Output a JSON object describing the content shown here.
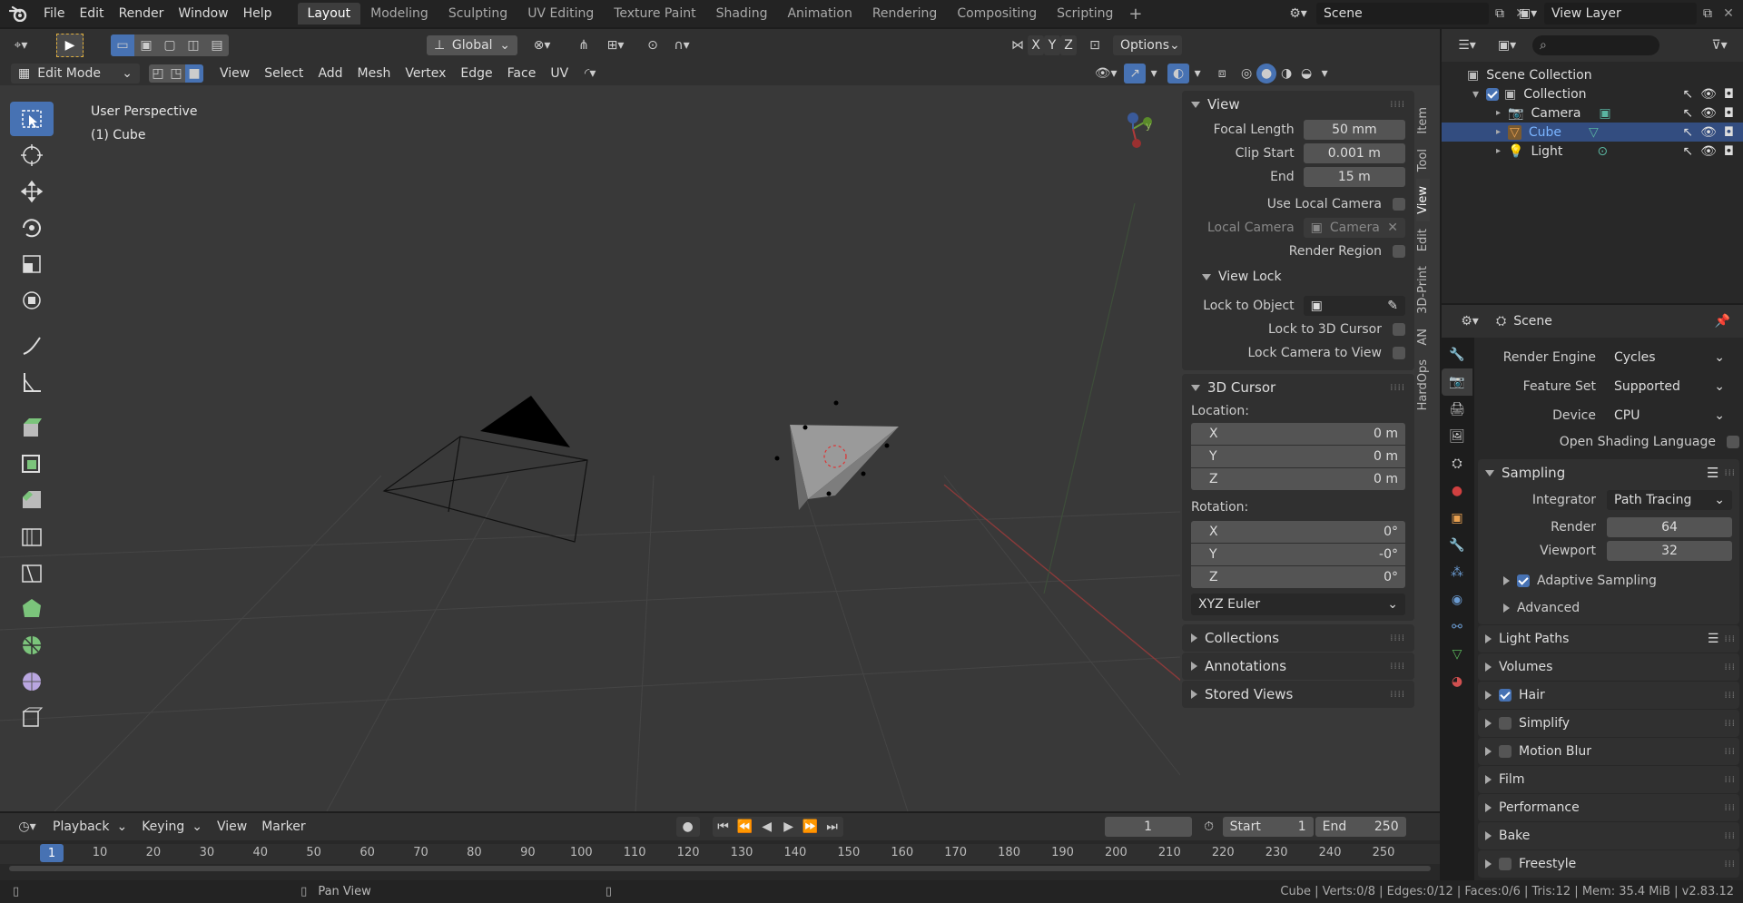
{
  "topbar": {
    "menus": [
      "File",
      "Edit",
      "Render",
      "Window",
      "Help"
    ],
    "workspaces": [
      "Layout",
      "Modeling",
      "Sculpting",
      "UV Editing",
      "Texture Paint",
      "Shading",
      "Animation",
      "Rendering",
      "Compositing",
      "Scripting"
    ],
    "active_workspace": "Layout",
    "scene_name": "Scene",
    "view_layer": "View Layer"
  },
  "header": {
    "orientation": "Global",
    "axes": [
      "X",
      "Y",
      "Z"
    ],
    "options_label": "Options",
    "mode": "Edit Mode",
    "menus": [
      "View",
      "Select",
      "Add",
      "Mesh",
      "Vertex",
      "Edge",
      "Face",
      "UV"
    ]
  },
  "viewport": {
    "perspective": "User Perspective",
    "object": "(1) Cube"
  },
  "sidebar": {
    "tabs": [
      "Item",
      "Tool",
      "View",
      "Edit",
      "3D-Print",
      "AN",
      "HardOps"
    ],
    "active_tab": "View",
    "view": {
      "title": "View",
      "focal_length_label": "Focal Length",
      "focal_length": "50 mm",
      "clip_start_label": "Clip Start",
      "clip_start": "0.001 m",
      "clip_end_label": "End",
      "clip_end": "15 m",
      "use_local_camera": "Use Local Camera",
      "local_camera_label": "Local Camera",
      "local_camera_value": "Camera",
      "render_region": "Render Region",
      "view_lock_title": "View Lock",
      "lock_to_object": "Lock to Object",
      "lock_to_cursor": "Lock to 3D Cursor",
      "lock_camera": "Lock Camera to View"
    },
    "cursor": {
      "title": "3D Cursor",
      "location_label": "Location:",
      "loc_x": "0 m",
      "loc_y": "0 m",
      "loc_z": "0 m",
      "rotation_label": "Rotation:",
      "rot_x": "0°",
      "rot_y": "-0°",
      "rot_z": "0°",
      "mode": "XYZ Euler"
    },
    "axis_labels": [
      "X",
      "Y",
      "Z"
    ],
    "collapsed": [
      "Collections",
      "Annotations",
      "Stored Views"
    ]
  },
  "outliner": {
    "root": "Scene Collection",
    "collection": "Collection",
    "items": [
      {
        "name": "Camera",
        "selected": false
      },
      {
        "name": "Cube",
        "selected": true
      },
      {
        "name": "Light",
        "selected": false
      }
    ]
  },
  "properties": {
    "title": "Scene",
    "render_engine_label": "Render Engine",
    "render_engine": "Cycles",
    "feature_set_label": "Feature Set",
    "feature_set": "Supported",
    "device_label": "Device",
    "device": "CPU",
    "osl_label": "Open Shading Language",
    "sampling_title": "Sampling",
    "integrator_label": "Integrator",
    "integrator": "Path Tracing",
    "render_label": "Render",
    "render_samples": "64",
    "viewport_label": "Viewport",
    "viewport_samples": "32",
    "adaptive_label": "Adaptive Sampling",
    "advanced_label": "Advanced",
    "panels": [
      {
        "name": "Light Paths",
        "check": null
      },
      {
        "name": "Volumes",
        "check": null
      },
      {
        "name": "Hair",
        "check": true
      },
      {
        "name": "Simplify",
        "check": false
      },
      {
        "name": "Motion Blur",
        "check": false
      },
      {
        "name": "Film",
        "check": null
      },
      {
        "name": "Performance",
        "check": null
      },
      {
        "name": "Bake",
        "check": null
      },
      {
        "name": "Freestyle",
        "check": false
      }
    ]
  },
  "timeline": {
    "menus": [
      "Playback",
      "Keying",
      "View",
      "Marker"
    ],
    "current_frame": "1",
    "start_label": "Start",
    "start": "1",
    "end_label": "End",
    "end": "250",
    "ticks": [
      "10",
      "20",
      "30",
      "40",
      "50",
      "60",
      "70",
      "80",
      "90",
      "100",
      "110",
      "120",
      "130",
      "140",
      "150",
      "160",
      "170",
      "180",
      "190",
      "200",
      "210",
      "220",
      "230",
      "240",
      "250"
    ]
  },
  "statusbar": {
    "hint": "Pan View",
    "stats": "Cube | Verts:0/8 | Edges:0/12 | Faces:0/6 | Tris:12 | Mem: 35.4 MiB | v2.83.12"
  },
  "colors": {
    "accent": "#4772b3",
    "selected_row": "#334d80",
    "viewport_bg": "#393939",
    "panel_bg": "#303030"
  }
}
